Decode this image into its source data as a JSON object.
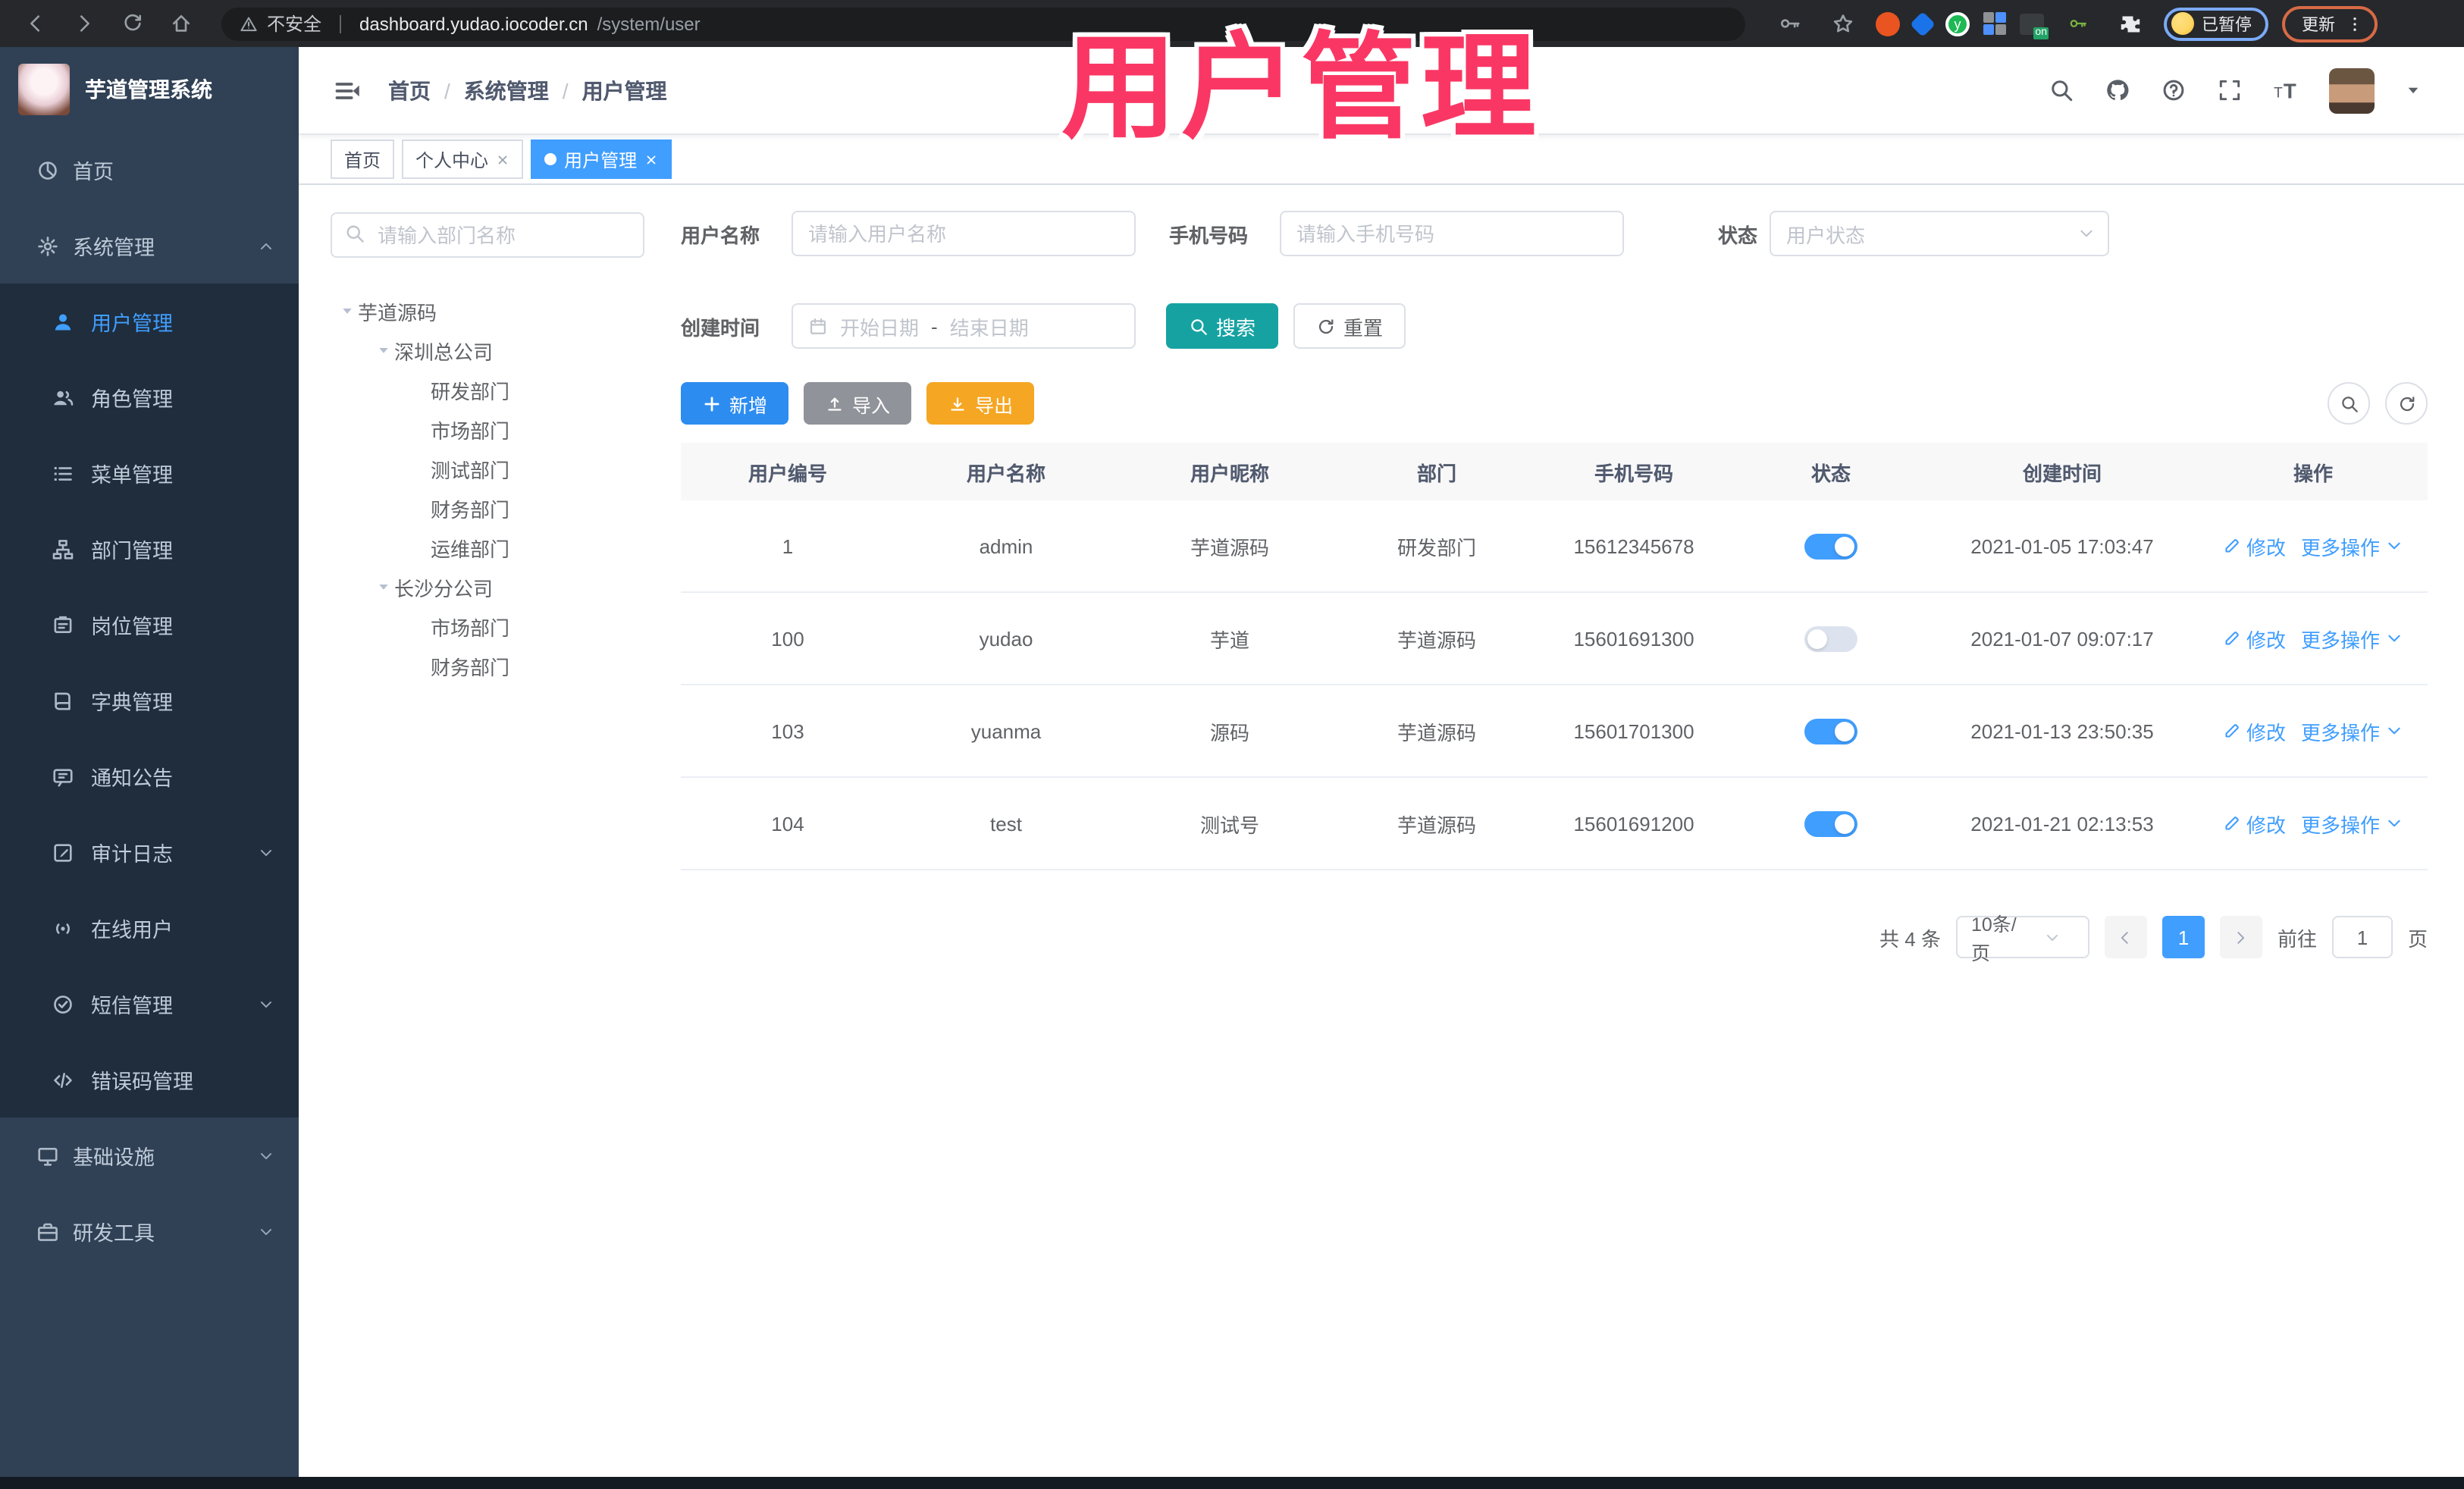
{
  "colors": {
    "primary": "#409eff",
    "search_teal": "#17a2a2",
    "add_blue": "#2d8cf0",
    "import_gray": "#909399",
    "export_amber": "#f5a623",
    "annotation_pink": "#fa3764",
    "sidebar_bg": "#304156",
    "submenu_bg": "#1f2d3d"
  },
  "annotation": {
    "text": "用户管理"
  },
  "browser": {
    "security_label": "不安全",
    "url_host": "dashboard.yudao.iocoder.cn",
    "url_path": "/system/user",
    "paused_label": "已暂停",
    "update_label": "更新"
  },
  "sidebar": {
    "logo_title": "芋道管理系统",
    "items": [
      {
        "label": "首页",
        "icon": "dashboard-icon"
      },
      {
        "label": "系统管理",
        "icon": "gear-icon",
        "arrow_icon": "chevron-up-icon"
      },
      {
        "label": "用户管理",
        "icon": "user-icon",
        "sub": true,
        "active": true
      },
      {
        "label": "角色管理",
        "icon": "role-icon",
        "sub": true
      },
      {
        "label": "菜单管理",
        "icon": "menu-list-icon",
        "sub": true
      },
      {
        "label": "部门管理",
        "icon": "org-tree-icon",
        "sub": true
      },
      {
        "label": "岗位管理",
        "icon": "badge-icon",
        "sub": true
      },
      {
        "label": "字典管理",
        "icon": "dict-icon",
        "sub": true
      },
      {
        "label": "通知公告",
        "icon": "notice-icon",
        "sub": true
      },
      {
        "label": "审计日志",
        "icon": "audit-icon",
        "sub": true,
        "arrow_icon": "chevron-down-icon"
      },
      {
        "label": "在线用户",
        "icon": "online-icon",
        "sub": true
      },
      {
        "label": "短信管理",
        "icon": "sms-icon",
        "sub": true,
        "arrow_icon": "chevron-down-icon"
      },
      {
        "label": "错误码管理",
        "icon": "code-icon",
        "sub": true
      },
      {
        "label": "基础设施",
        "icon": "infra-icon",
        "arrow_icon": "chevron-down-icon"
      },
      {
        "label": "研发工具",
        "icon": "devtools-icon",
        "arrow_icon": "chevron-down-icon"
      }
    ]
  },
  "header": {
    "breadcrumb": [
      "首页",
      "系统管理",
      "用户管理"
    ],
    "right_icons": [
      {
        "icon": "search-icon"
      },
      {
        "icon": "github-icon"
      },
      {
        "icon": "question-icon"
      },
      {
        "icon": "fullscreen-icon"
      },
      {
        "icon": "font-size-icon"
      }
    ]
  },
  "tabs": [
    {
      "label": "首页",
      "closable": false,
      "active": false
    },
    {
      "label": "个人中心",
      "closable": true,
      "active": false
    },
    {
      "label": "用户管理",
      "closable": true,
      "active": true
    }
  ],
  "tree": {
    "search_placeholder": "请输入部门名称",
    "nodes": [
      {
        "label": "芋道源码",
        "level": 0,
        "expandable": true
      },
      {
        "label": "深圳总公司",
        "level": 1,
        "expandable": true
      },
      {
        "label": "研发部门",
        "level": 2
      },
      {
        "label": "市场部门",
        "level": 2
      },
      {
        "label": "测试部门",
        "level": 2
      },
      {
        "label": "财务部门",
        "level": 2
      },
      {
        "label": "运维部门",
        "level": 2
      },
      {
        "label": "长沙分公司",
        "level": 1,
        "expandable": true
      },
      {
        "label": "市场部门",
        "level": 2
      },
      {
        "label": "财务部门",
        "level": 2
      }
    ]
  },
  "filters": {
    "username_label": "用户名称",
    "username_placeholder": "请输入用户名称",
    "mobile_label": "手机号码",
    "mobile_placeholder": "请输入手机号码",
    "status_label": "状态",
    "status_placeholder": "用户状态",
    "create_time_label": "创建时间",
    "date_start_placeholder": "开始日期",
    "date_separator": "-",
    "date_end_placeholder": "结束日期",
    "search_label": "搜索",
    "reset_label": "重置"
  },
  "toolbar": {
    "add_label": "新增",
    "import_label": "导入",
    "export_label": "导出"
  },
  "table": {
    "columns": [
      "用户编号",
      "用户名称",
      "用户昵称",
      "部门",
      "手机号码",
      "状态",
      "创建时间",
      "操作"
    ],
    "actions": {
      "edit": "修改",
      "more": "更多操作"
    },
    "rows": [
      {
        "id": "1",
        "username": "admin",
        "nickname": "芋道源码",
        "dept": "研发部门",
        "mobile": "15612345678",
        "status_on": true,
        "created": "2021-01-05 17:03:47"
      },
      {
        "id": "100",
        "username": "yudao",
        "nickname": "芋道",
        "dept": "芋道源码",
        "mobile": "15601691300",
        "status_on": false,
        "created": "2021-01-07 09:07:17"
      },
      {
        "id": "103",
        "username": "yuanma",
        "nickname": "源码",
        "dept": "芋道源码",
        "mobile": "15601701300",
        "status_on": true,
        "created": "2021-01-13 23:50:35"
      },
      {
        "id": "104",
        "username": "test",
        "nickname": "测试号",
        "dept": "芋道源码",
        "mobile": "15601691200",
        "status_on": true,
        "created": "2021-01-21 02:13:53"
      }
    ]
  },
  "pagination": {
    "total_text": "共 4 条",
    "page_size": "10条/页",
    "current_page": "1",
    "goto_label": "前往",
    "goto_value": "1",
    "page_unit": "页"
  }
}
